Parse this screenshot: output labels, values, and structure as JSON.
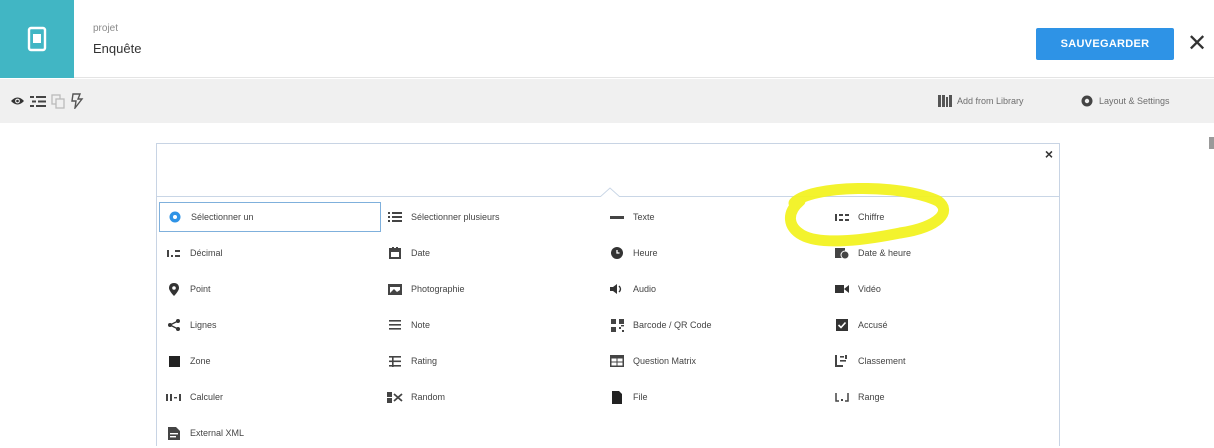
{
  "header": {
    "project_label": "projet",
    "project_title": "Enquête",
    "save_label": "SAUVEGARDER",
    "close_glyph": "✕"
  },
  "toolbar": {
    "add_from_library": "Add from Library",
    "layout_settings": "Layout & Settings"
  },
  "modal": {
    "close_glyph": "×"
  },
  "question_types": [
    {
      "label": "Sélectionner un",
      "icon": "radio-icon"
    },
    {
      "label": "Sélectionner plusieurs",
      "icon": "list-icon"
    },
    {
      "label": "Texte",
      "icon": "text-icon"
    },
    {
      "label": "Chiffre",
      "icon": "number-icon"
    },
    {
      "label": "Décimal",
      "icon": "decimal-icon"
    },
    {
      "label": "Date",
      "icon": "calendar-icon"
    },
    {
      "label": "Heure",
      "icon": "clock-icon"
    },
    {
      "label": "Date & heure",
      "icon": "datetime-icon"
    },
    {
      "label": "Point",
      "icon": "map-pin-icon"
    },
    {
      "label": "Photographie",
      "icon": "image-icon"
    },
    {
      "label": "Audio",
      "icon": "audio-icon"
    },
    {
      "label": "Vidéo",
      "icon": "video-icon"
    },
    {
      "label": "Lignes",
      "icon": "share-icon"
    },
    {
      "label": "Note",
      "icon": "note-icon"
    },
    {
      "label": "Barcode / QR Code",
      "icon": "qr-code-icon"
    },
    {
      "label": "Accusé",
      "icon": "check-square-icon"
    },
    {
      "label": "Zone",
      "icon": "square-icon"
    },
    {
      "label": "Rating",
      "icon": "rating-icon"
    },
    {
      "label": "Question Matrix",
      "icon": "table-icon"
    },
    {
      "label": "Classement",
      "icon": "sort-icon"
    },
    {
      "label": "Calculer",
      "icon": "calculate-icon"
    },
    {
      "label": "Random",
      "icon": "random-icon"
    },
    {
      "label": "File",
      "icon": "file-icon"
    },
    {
      "label": "Range",
      "icon": "range-icon"
    },
    {
      "label": "External XML",
      "icon": "external-xml-icon"
    }
  ],
  "colors": {
    "brand_teal": "#41b6c4",
    "save_blue": "#2e93e6",
    "highlight_yellow": "#f2f222"
  }
}
